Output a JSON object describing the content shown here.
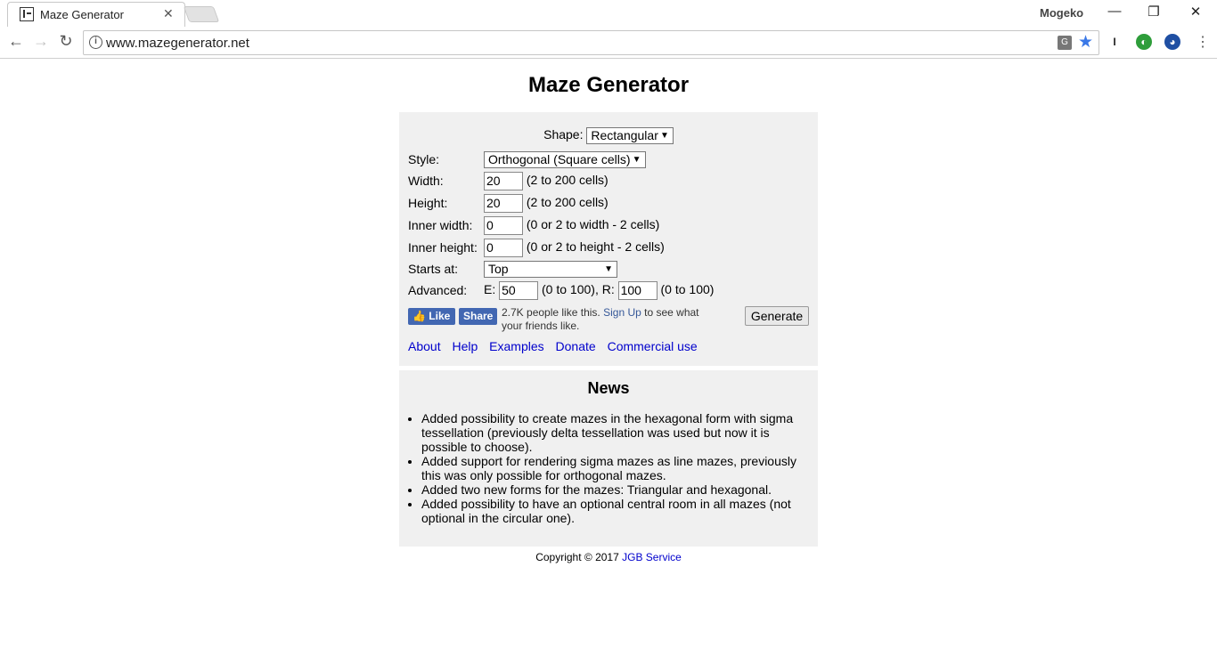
{
  "browser": {
    "tab_title": "Maze Generator",
    "profile_name": "Mogeko",
    "url": "www.mazegenerator.net"
  },
  "page": {
    "title": "Maze Generator"
  },
  "form": {
    "shape_label": "Shape:",
    "shape_value": "Rectangular",
    "style_label": "Style:",
    "style_value": "Orthogonal (Square cells)",
    "width_label": "Width:",
    "width_value": "20",
    "width_hint": "(2 to 200 cells)",
    "height_label": "Height:",
    "height_value": "20",
    "height_hint": "(2 to 200 cells)",
    "inner_width_label": "Inner width:",
    "inner_width_value": "0",
    "inner_width_hint": "(0 or 2 to width - 2 cells)",
    "inner_height_label": "Inner height:",
    "inner_height_value": "0",
    "inner_height_hint": "(0 or 2 to height - 2 cells)",
    "starts_label": "Starts at:",
    "starts_value": "Top",
    "advanced_label": "Advanced:",
    "e_label": "E:",
    "e_value": "50",
    "e_hint": "(0 to 100), R:",
    "r_value": "100",
    "r_hint": "(0 to 100)",
    "generate_label": "Generate"
  },
  "social": {
    "like_label": "Like",
    "share_label": "Share",
    "count_text": "2.7K people like this.",
    "signup_label": "Sign Up",
    "after_text": "to see what your friends like."
  },
  "links": [
    "About",
    "Help",
    "Examples",
    "Donate",
    "Commercial use"
  ],
  "news": {
    "title": "News",
    "items": [
      "Added possibility to create mazes in the hexagonal form with sigma tessellation (previously delta tessellation was used but now it is possible to choose).",
      "Added support for rendering sigma mazes as line mazes, previously this was only possible for orthogonal mazes.",
      "Added two new forms for the mazes: Triangular and hexagonal.",
      "Added possibility to have an optional central room in all mazes (not optional in the circular one)."
    ]
  },
  "footer": {
    "copyright": "Copyright © 2017",
    "company": "JGB Service"
  },
  "colors": {
    "panel_bg": "#f0f0f0",
    "link": "#0000cc",
    "facebook": "#4267b2",
    "star": "#3a78e7"
  }
}
